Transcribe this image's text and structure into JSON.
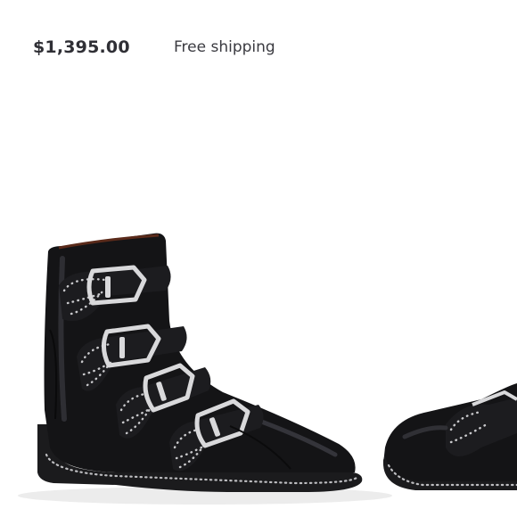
{
  "listing": {
    "price": "$1,395.00",
    "shipping": "Free shipping"
  },
  "product_image": {
    "subject": "black leather ankle boot with studded buckle straps",
    "colors": {
      "leather": "#121214",
      "highlight": "#3a3a3e",
      "buckle": "#d9d9db",
      "stud": "#c9c9cc",
      "sole": "#1b1b1d"
    }
  }
}
